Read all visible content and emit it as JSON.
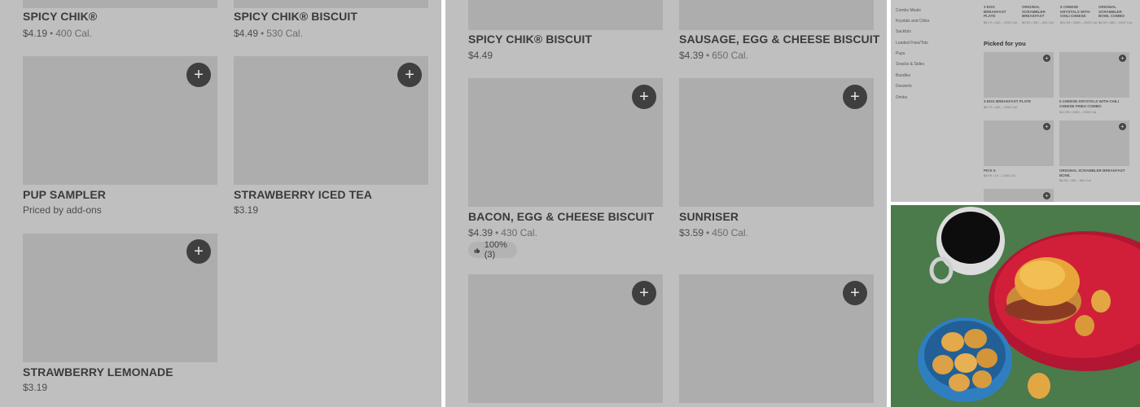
{
  "panel1": {
    "items": [
      {
        "name": "SPICY CHIK®",
        "price": "$4.19",
        "cal": "400 Cal."
      },
      {
        "name": "SPICY CHIK® BISCUIT",
        "price": "$4.49",
        "cal": "530 Cal."
      },
      {
        "name": "PUP SAMPLER",
        "price": "Priced by add-ons",
        "cal": ""
      },
      {
        "name": "STRAWBERRY ICED TEA",
        "price": "$3.19",
        "cal": ""
      },
      {
        "name": "STRAWBERRY LEMONADE",
        "price": "$3.19",
        "cal": ""
      }
    ]
  },
  "panel2": {
    "items": [
      {
        "name": "SPICY CHIK® BISCUIT",
        "price": "$4.49",
        "cal": ""
      },
      {
        "name": "SAUSAGE, EGG & CHEESE BISCUIT",
        "price": "$4.39",
        "cal": "650 Cal."
      },
      {
        "name": "BACON, EGG & CHEESE BISCUIT",
        "price": "$4.39",
        "cal": "430 Cal.",
        "rating": "100% (3)"
      },
      {
        "name": "SUNRISER",
        "price": "$3.59",
        "cal": "450 Cal."
      }
    ]
  },
  "panel3": {
    "sidebar": [
      "Combo Meals",
      "Krystals and Chiks",
      "Sackfuls",
      "Loaded Fries/Tots",
      "Pups",
      "Snacks & Sides",
      "Bundles",
      "Desserts",
      "Drinks"
    ],
    "top_items": [
      {
        "name": "3 EGG BREAKFAST PLATE",
        "meta": "$6.79 • 440 – 1050 Cal."
      },
      {
        "name": "ORIGINAL SCRAMBLER BREAKFAST",
        "meta": "$5.59 • 340 – 840 Cal."
      },
      {
        "name": "5 CHEESE KRYSTALS WITH CHILI CHEESE",
        "meta": "$22.99 • 1690 – 2500 Cal."
      },
      {
        "name": "ORIGINAL SCRAMBLER BOWL COMBO",
        "meta": "$8.39 • 560 – 1000 Cal."
      }
    ],
    "picked_heading": "Picked for you",
    "picked": [
      {
        "name": "3 EGG BREAKFAST PLATE",
        "meta": "$6.79 • 440 – 1050 Cal."
      },
      {
        "name": "5 CHEESE KRYSTALS WITH CHILI CHEESE FRIES COMBO",
        "meta": "$22.99 • 1690 – 2500 Cal."
      },
      {
        "name": "PICK 5",
        "meta": "$8.99 • 10 – 1250 Cal."
      },
      {
        "name": "ORIGINAL SCRAMBLER BREAKFAST BOWL",
        "meta": "$5.59 • 400 – 840 Cal."
      }
    ]
  },
  "icons": {
    "add": "+"
  },
  "colors": {
    "panel_bg": "#bfbfbf",
    "thumb": "#adadad",
    "add_button": "#3f3f3f",
    "photo_bg": "#4b7a4b",
    "plate": "#d11f3a",
    "bowl": "#2f7fc0"
  }
}
